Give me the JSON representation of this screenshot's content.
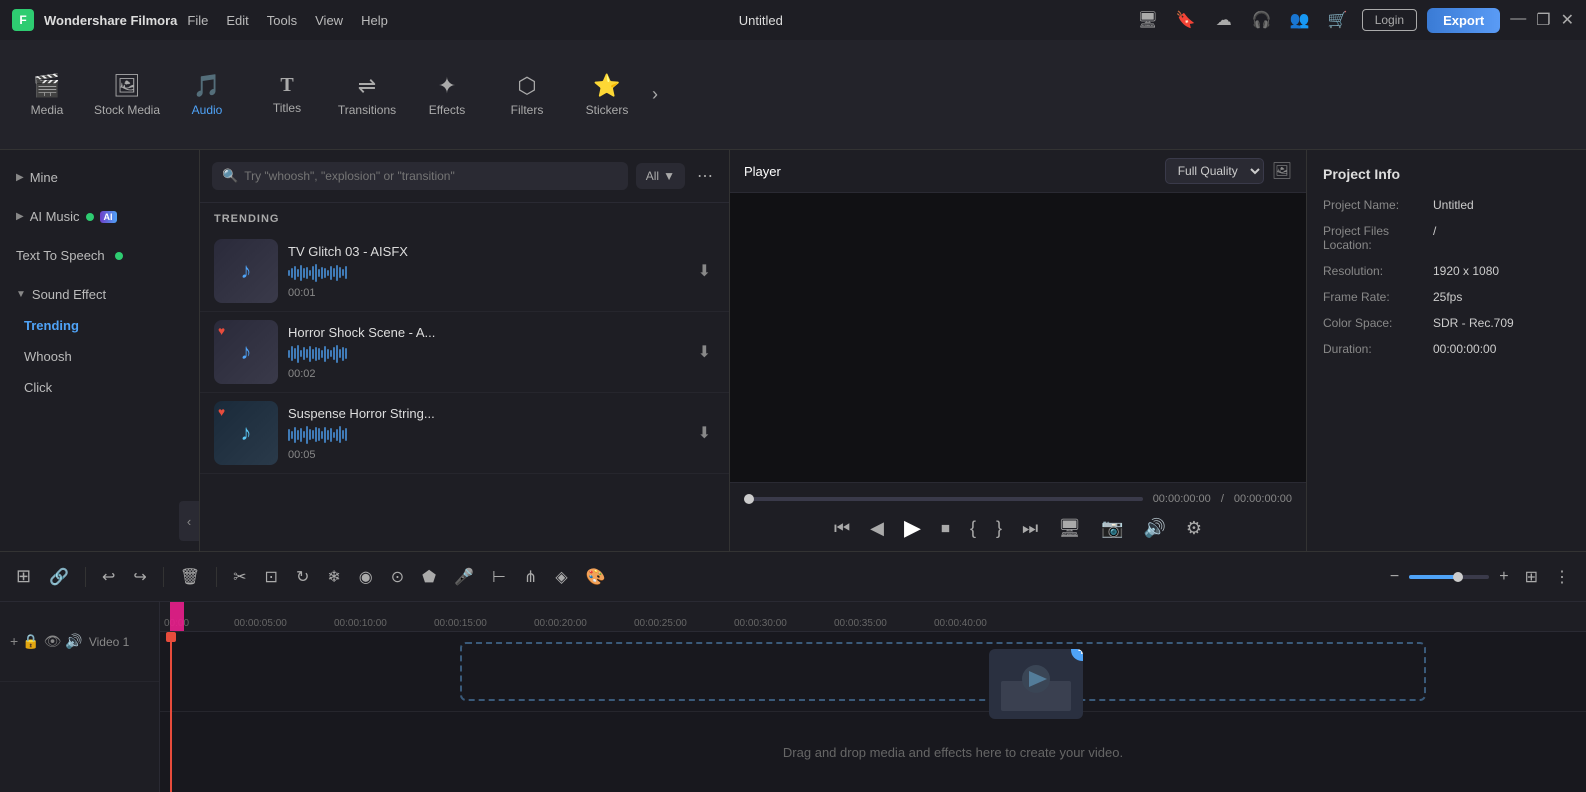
{
  "app": {
    "name": "Wondershare Filmora",
    "title": "Untitled"
  },
  "titlebar": {
    "menu_items": [
      "File",
      "Edit",
      "Tools",
      "View",
      "Help"
    ],
    "login_label": "Login",
    "export_label": "Export"
  },
  "toolbar": {
    "items": [
      {
        "id": "media",
        "label": "Media",
        "icon": "🎬"
      },
      {
        "id": "stock_media",
        "label": "Stock Media",
        "icon": "📷"
      },
      {
        "id": "audio",
        "label": "Audio",
        "icon": "🎵"
      },
      {
        "id": "titles",
        "label": "Titles",
        "icon": "T"
      },
      {
        "id": "transitions",
        "label": "Transitions",
        "icon": "↔"
      },
      {
        "id": "effects",
        "label": "Effects",
        "icon": "✦"
      },
      {
        "id": "filters",
        "label": "Filters",
        "icon": "⬡"
      },
      {
        "id": "stickers",
        "label": "Stickers",
        "icon": "⭐"
      }
    ]
  },
  "sidebar": {
    "mine_label": "Mine",
    "ai_music_label": "AI Music",
    "text_to_speech_label": "Text To Speech",
    "sound_effect_label": "Sound Effect",
    "sound_effect_children": [
      {
        "id": "trending",
        "label": "Trending",
        "active": true
      },
      {
        "id": "whoosh",
        "label": "Whoosh"
      },
      {
        "id": "click",
        "label": "Click"
      }
    ]
  },
  "search": {
    "placeholder": "Try \"whoosh\", \"explosion\" or \"transition\"",
    "filter_label": "All"
  },
  "trending": {
    "label": "TRENDING",
    "items": [
      {
        "id": 1,
        "title": "TV Glitch 03 - AISFX",
        "duration": "00:01",
        "has_heart": false
      },
      {
        "id": 2,
        "title": "Horror Shock Scene - A...",
        "duration": "00:02",
        "has_heart": true
      },
      {
        "id": 3,
        "title": "Suspense Horror String...",
        "duration": "00:05",
        "has_heart": true
      }
    ]
  },
  "player": {
    "tab_player": "Player",
    "quality_label": "Full Quality",
    "time_current": "00:00:00:00",
    "time_total": "00:00:00:00"
  },
  "project_info": {
    "title": "Project Info",
    "fields": [
      {
        "label": "Project Name:",
        "value": "Untitled"
      },
      {
        "label": "Project Files Location:",
        "value": "/"
      },
      {
        "label": "Resolution:",
        "value": "1920 x 1080"
      },
      {
        "label": "Frame Rate:",
        "value": "25fps"
      },
      {
        "label": "Color Space:",
        "value": "SDR - Rec.709"
      },
      {
        "label": "Duration:",
        "value": "00:00:00:00"
      }
    ]
  },
  "timeline": {
    "ruler_marks": [
      "00:00",
      "00:00:05:00",
      "00:00:10:00",
      "00:00:15:00",
      "00:00:20:00",
      "00:00:25:00",
      "00:00:30:00",
      "00:00:35:00",
      "00:00:40:00"
    ],
    "drop_text": "Drag and drop media and effects here to create your video.",
    "track_label": "Video 1",
    "add_track_label": "+"
  },
  "icons": {
    "search": "🔍",
    "download": "⬇",
    "heart": "♥",
    "music_note": "♪",
    "chevron_right": "›",
    "chevron_down": "∨",
    "chevron_left": "‹",
    "more": "⋯",
    "play": "▶",
    "pause": "⏸",
    "step_back": "⏮",
    "step_fwd": "⏭",
    "stop": "⏹",
    "mark_in": "{",
    "mark_out": "}",
    "camera": "📷",
    "scissors": "✂",
    "undo": "↩",
    "redo": "↪",
    "delete": "🗑",
    "split": "⊢",
    "speed": "⏩",
    "crop": "⊡",
    "color": "🎨",
    "voice": "🎤",
    "transition_add": "⊞",
    "grid": "⊞",
    "minus": "−",
    "plus": "+",
    "lock": "🔒",
    "eye": "👁",
    "speaker": "🔊",
    "link": "🔗"
  }
}
